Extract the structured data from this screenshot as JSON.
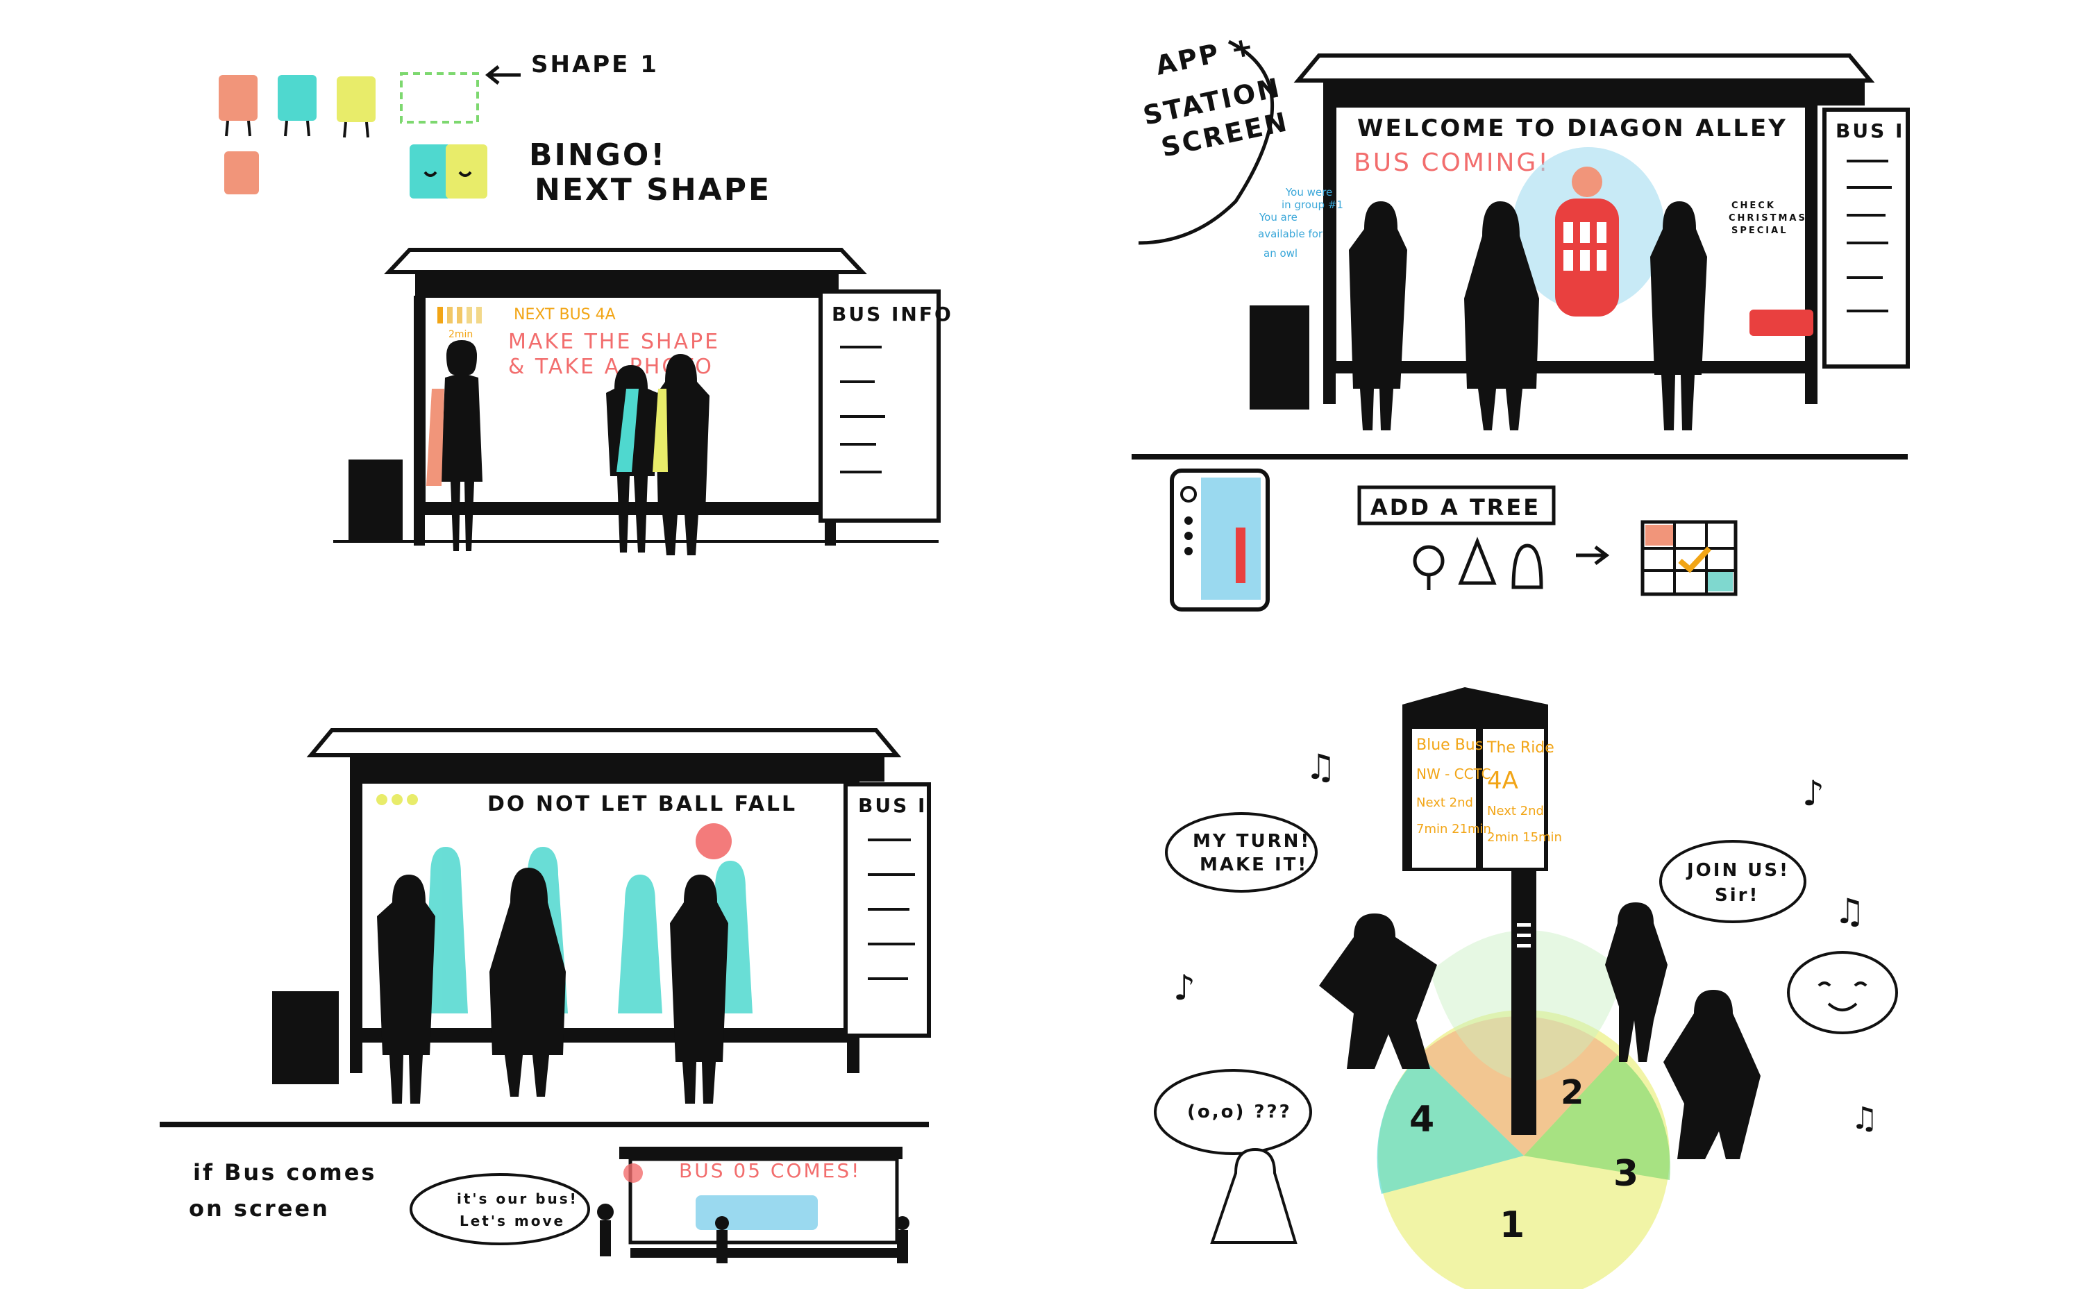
{
  "panel1": {
    "shape_label": "SHAPE 1",
    "bingo_line1": "BINGO!",
    "bingo_line2": "NEXT SHAPE",
    "next_bus": "NEXT BUS 4A",
    "timer": "2min",
    "instruction_line1": "MAKE THE SHAPE",
    "instruction_line2": "& TAKE A PHOTO",
    "bus_info": "BUS INFO"
  },
  "panel2": {
    "title_line1": "APP +",
    "title_line2": "STATION",
    "title_line3": "SCREEN",
    "welcome": "WELCOME TO DIAGON ALLEY",
    "bus_coming": "BUS COMING!",
    "note_line1": "You were",
    "note_line2": "in group #1",
    "note_line3": "You are",
    "note_line4": "available for",
    "note_line5": "an owl",
    "check_line1": "CHECK",
    "check_line2": "CHRISTMAS",
    "check_line3": "SPECIAL",
    "bus_info": "BUS I",
    "add_tree": "ADD A TREE"
  },
  "panel3": {
    "game_text": "DO NOT LET BALL FALL",
    "bus_info": "BUS I",
    "caption_line1": "if Bus comes",
    "caption_line2": "on screen",
    "bubble_line1": "it's our bus!",
    "bubble_line2": "Let's move",
    "bus_comes": "BUS 05 COMES!"
  },
  "panel4": {
    "screen_left_line1": "Blue Bus",
    "screen_left_line2": "NW - CCTC",
    "screen_left_line3": "Next 2nd",
    "screen_left_line4": "7min 21min",
    "screen_right_line1": "The Ride",
    "screen_right_line2": "4A",
    "screen_right_line3": "Next 2nd",
    "screen_right_line4": "2min 15min",
    "bubble_left_line1": "MY TURN!",
    "bubble_left_line2": "MAKE IT!",
    "bubble_right_line1": "JOIN US!",
    "bubble_right_line2": "Sir!",
    "bubble_bottom": "(o,o) ???",
    "num1": "1",
    "num2": "2",
    "num3": "3",
    "num4": "4"
  },
  "colors": {
    "ink": "#111111",
    "coral": "#f26d6d",
    "teal": "#4fd8cf",
    "yellow": "#e8ec6a",
    "orange": "#f2a516",
    "salmon": "#f1957a",
    "sky": "#9ad9ef",
    "red": "#e9403f"
  }
}
